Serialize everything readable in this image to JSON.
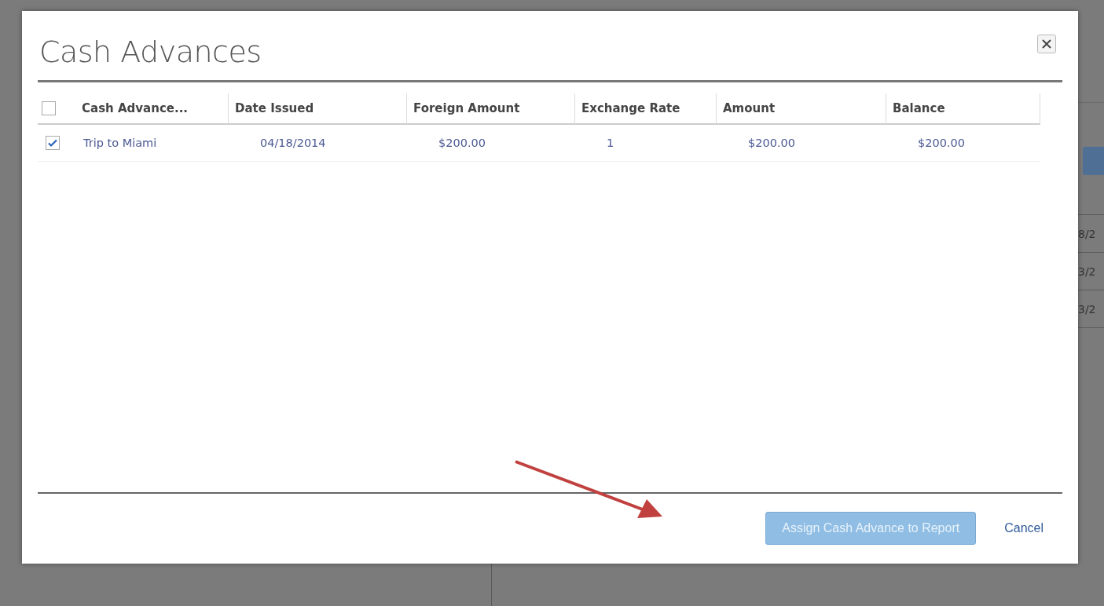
{
  "background": {
    "table_cells": [
      "8/2",
      "3/2",
      "3/2"
    ]
  },
  "dialog": {
    "title": "Cash Advances",
    "table": {
      "select_all": {
        "checked": false
      },
      "columns": [
        "Cash Advance...",
        "Date Issued",
        "Foreign Amount",
        "Exchange Rate",
        "Amount",
        "Balance"
      ],
      "rows": [
        {
          "checked": true,
          "cells": [
            "Trip to Miami",
            "04/18/2014",
            "$200.00",
            "1",
            "$200.00",
            "$200.00"
          ]
        }
      ]
    },
    "buttons": [
      {
        "kind": "primary",
        "label": "Assign Cash Advance to Report",
        "disabled": true
      },
      {
        "kind": "link",
        "label": "Cancel",
        "disabled": false
      }
    ]
  }
}
